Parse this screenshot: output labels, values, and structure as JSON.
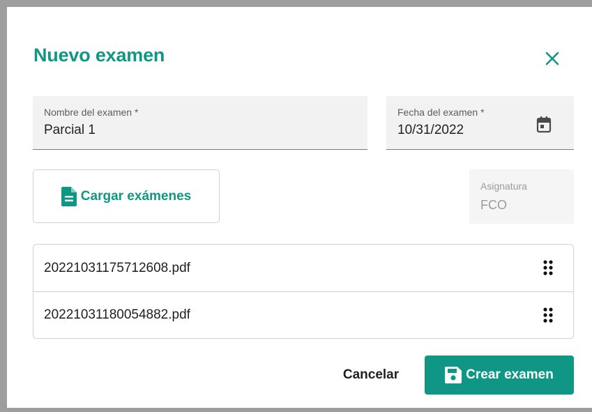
{
  "dialog": {
    "title": "Nuevo examen",
    "close_icon": "close-icon"
  },
  "form": {
    "exam_name": {
      "label": "Nombre del examen *",
      "value": "Parcial 1"
    },
    "exam_date": {
      "label": "Fecha del examen *",
      "value": "10/31/2022",
      "icon": "calendar-icon"
    },
    "subject": {
      "label": "Asignatura",
      "value": "FCO",
      "disabled": true
    },
    "upload_button": {
      "label": "Cargar exámenes",
      "icon": "file-icon"
    }
  },
  "files": [
    {
      "name": "20221031175712608.pdf",
      "icon": "drag-handle-icon"
    },
    {
      "name": "20221031180054882.pdf",
      "icon": "drag-handle-icon"
    }
  ],
  "actions": {
    "cancel_label": "Cancelar",
    "create_label": "Crear examen",
    "create_icon": "save-icon"
  },
  "colors": {
    "accent": "#0f9684",
    "field_bg": "#f2f2f2",
    "text": "#1f1f1f",
    "muted": "#9a9a9a"
  }
}
